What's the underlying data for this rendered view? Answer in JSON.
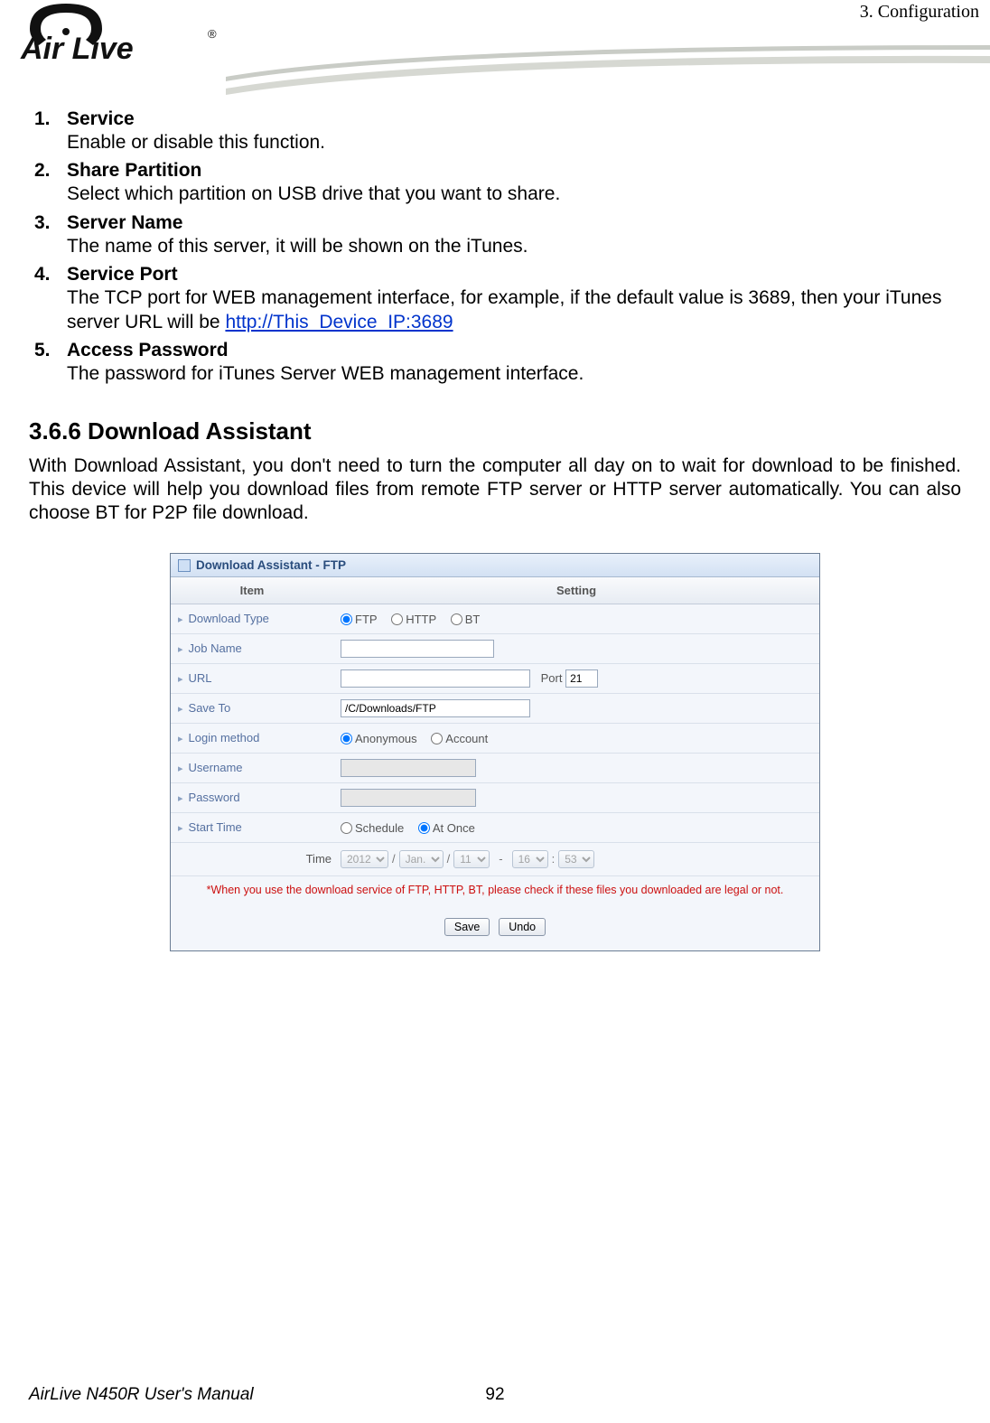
{
  "header": {
    "chapter": "3. Configuration"
  },
  "logo": {
    "brand_top": "Air Live",
    "reg": "®"
  },
  "list": [
    {
      "num": "1.",
      "title": "Service",
      "desc": "Enable or disable this function."
    },
    {
      "num": "2.",
      "title": "Share Partition",
      "desc": "Select which partition on USB drive that you want to share."
    },
    {
      "num": "3.",
      "title": "Server Name",
      "desc": "The name of this server, it will be shown on the iTunes."
    },
    {
      "num": "4.",
      "title": "Service Port",
      "desc_pre": "The TCP port for WEB management interface, for example, if the default value is 3689, then your iTunes server URL will be ",
      "link": "http://This_Device_IP:3689"
    },
    {
      "num": "5.",
      "title": "Access Password",
      "desc": "The password for iTunes Server WEB management interface."
    }
  ],
  "section": {
    "heading": "3.6.6 Download Assistant",
    "para": "With Download Assistant, you don't need to turn the computer all day on to wait for download to be finished. This device will help you download files from remote FTP server or HTTP server automatically. You can also choose BT for P2P file download."
  },
  "panel": {
    "title": "Download Assistant - FTP",
    "thead": {
      "item": "Item",
      "setting": "Setting"
    },
    "rows": {
      "download_type": {
        "label": "Download Type",
        "opts": {
          "ftp": "FTP",
          "http": "HTTP",
          "bt": "BT"
        }
      },
      "job_name": {
        "label": "Job Name",
        "value": ""
      },
      "url": {
        "label": "URL",
        "value": "",
        "port_label": "Port",
        "port_value": "21"
      },
      "save_to": {
        "label": "Save To",
        "value": "/C/Downloads/FTP"
      },
      "login": {
        "label": "Login method",
        "opts": {
          "anon": "Anonymous",
          "acct": "Account"
        }
      },
      "username": {
        "label": "Username",
        "value": ""
      },
      "password": {
        "label": "Password",
        "value": ""
      },
      "start_time": {
        "label": "Start Time",
        "opts": {
          "schedule": "Schedule",
          "at_once": "At Once"
        }
      },
      "time": {
        "label": "Time",
        "year": "2012",
        "month": "Jan.",
        "day": "11",
        "hour": "16",
        "minute": "53",
        "slash": "/",
        "dash": "-",
        "colon": ":"
      }
    },
    "warning": "*When you use the download service of FTP, HTTP, BT, please check if these files you downloaded are legal or not.",
    "buttons": {
      "save": "Save",
      "undo": "Undo"
    }
  },
  "footer": {
    "manual": "AirLive N450R User's Manual",
    "page": "92"
  }
}
